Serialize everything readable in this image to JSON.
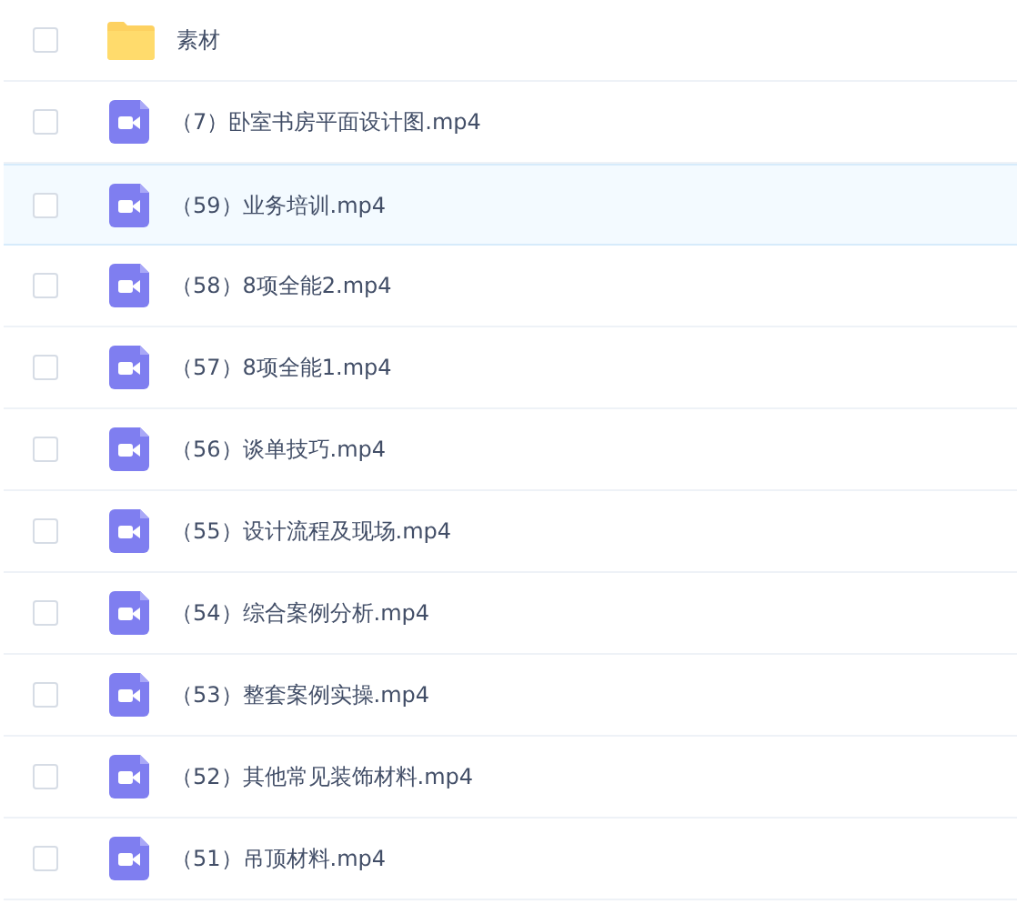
{
  "files": [
    {
      "kind": "folder",
      "name": "素材",
      "selected": false
    },
    {
      "kind": "video",
      "name": "（7）卧室书房平面设计图.mp4",
      "selected": false
    },
    {
      "kind": "video",
      "name": "（59）业务培训.mp4",
      "selected": true
    },
    {
      "kind": "video",
      "name": "（58）8项全能2.mp4",
      "selected": false
    },
    {
      "kind": "video",
      "name": "（57）8项全能1.mp4",
      "selected": false
    },
    {
      "kind": "video",
      "name": "（56）谈单技巧.mp4",
      "selected": false
    },
    {
      "kind": "video",
      "name": "（55）设计流程及现场.mp4",
      "selected": false
    },
    {
      "kind": "video",
      "name": "（54）综合案例分析.mp4",
      "selected": false
    },
    {
      "kind": "video",
      "name": "（53）整套案例实操.mp4",
      "selected": false
    },
    {
      "kind": "video",
      "name": "（52）其他常见装饰材料.mp4",
      "selected": false
    },
    {
      "kind": "video",
      "name": "（51）吊顶材料.mp4",
      "selected": false
    }
  ]
}
